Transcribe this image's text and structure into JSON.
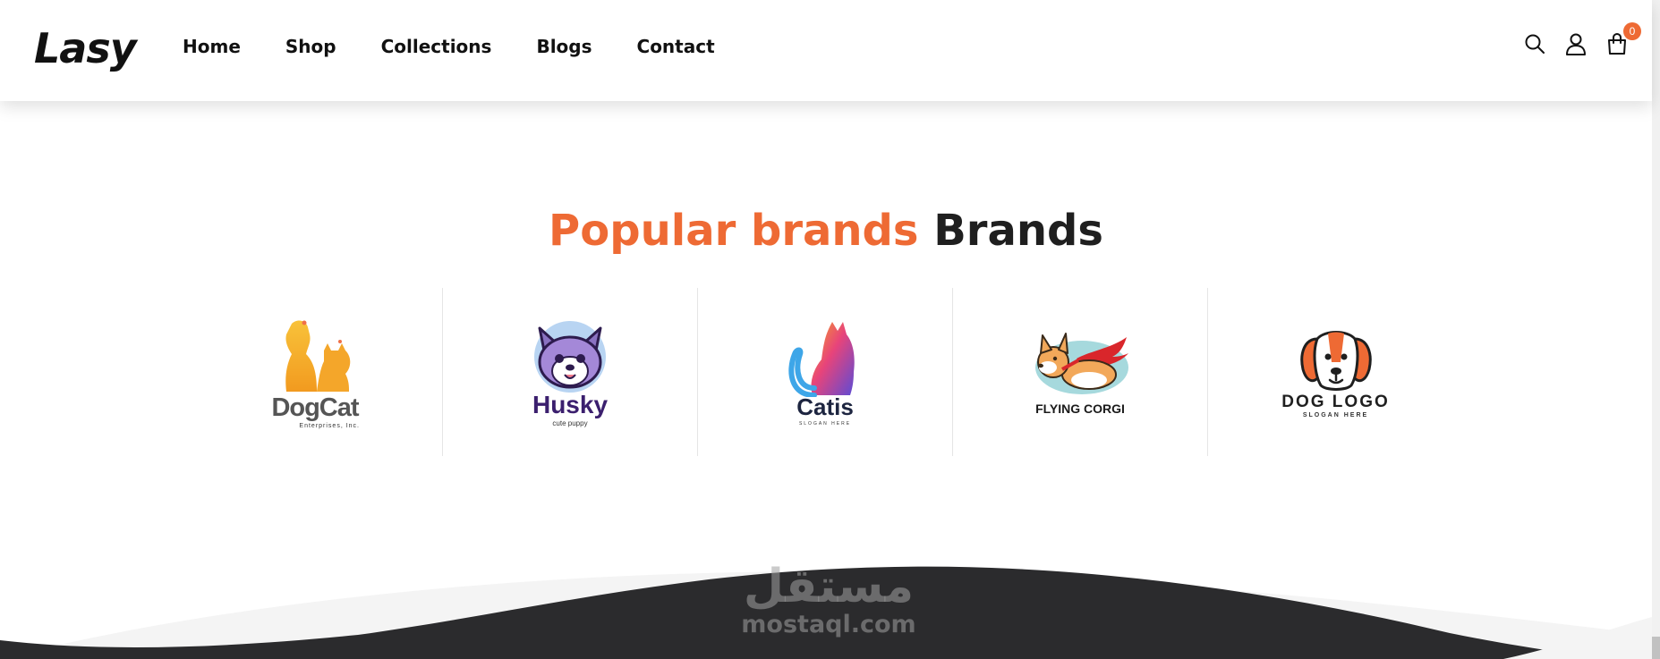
{
  "header": {
    "logo": "Lasy",
    "nav": [
      "Home",
      "Shop",
      "Collections",
      "Blogs",
      "Contact"
    ],
    "cart_count": "0"
  },
  "section": {
    "title_accent": "Popular brands",
    "title_rest": "Brands"
  },
  "brands": [
    {
      "name": "DogCat",
      "sub": "Enterprises, Inc."
    },
    {
      "name": "Husky",
      "sub": "cute puppy"
    },
    {
      "name": "Catis",
      "sub": "SLOGAN HERE"
    },
    {
      "name": "FLYING CORGI",
      "sub": ""
    },
    {
      "name": "DOG LOGO",
      "sub": "SLOGAN HERE"
    }
  ],
  "watermark": {
    "arabic": "مستقل",
    "latin": "mostaql.com"
  },
  "colors": {
    "accent": "#ee6a34",
    "text": "#1f1f1f",
    "footer_dark": "#2b2b2d"
  }
}
